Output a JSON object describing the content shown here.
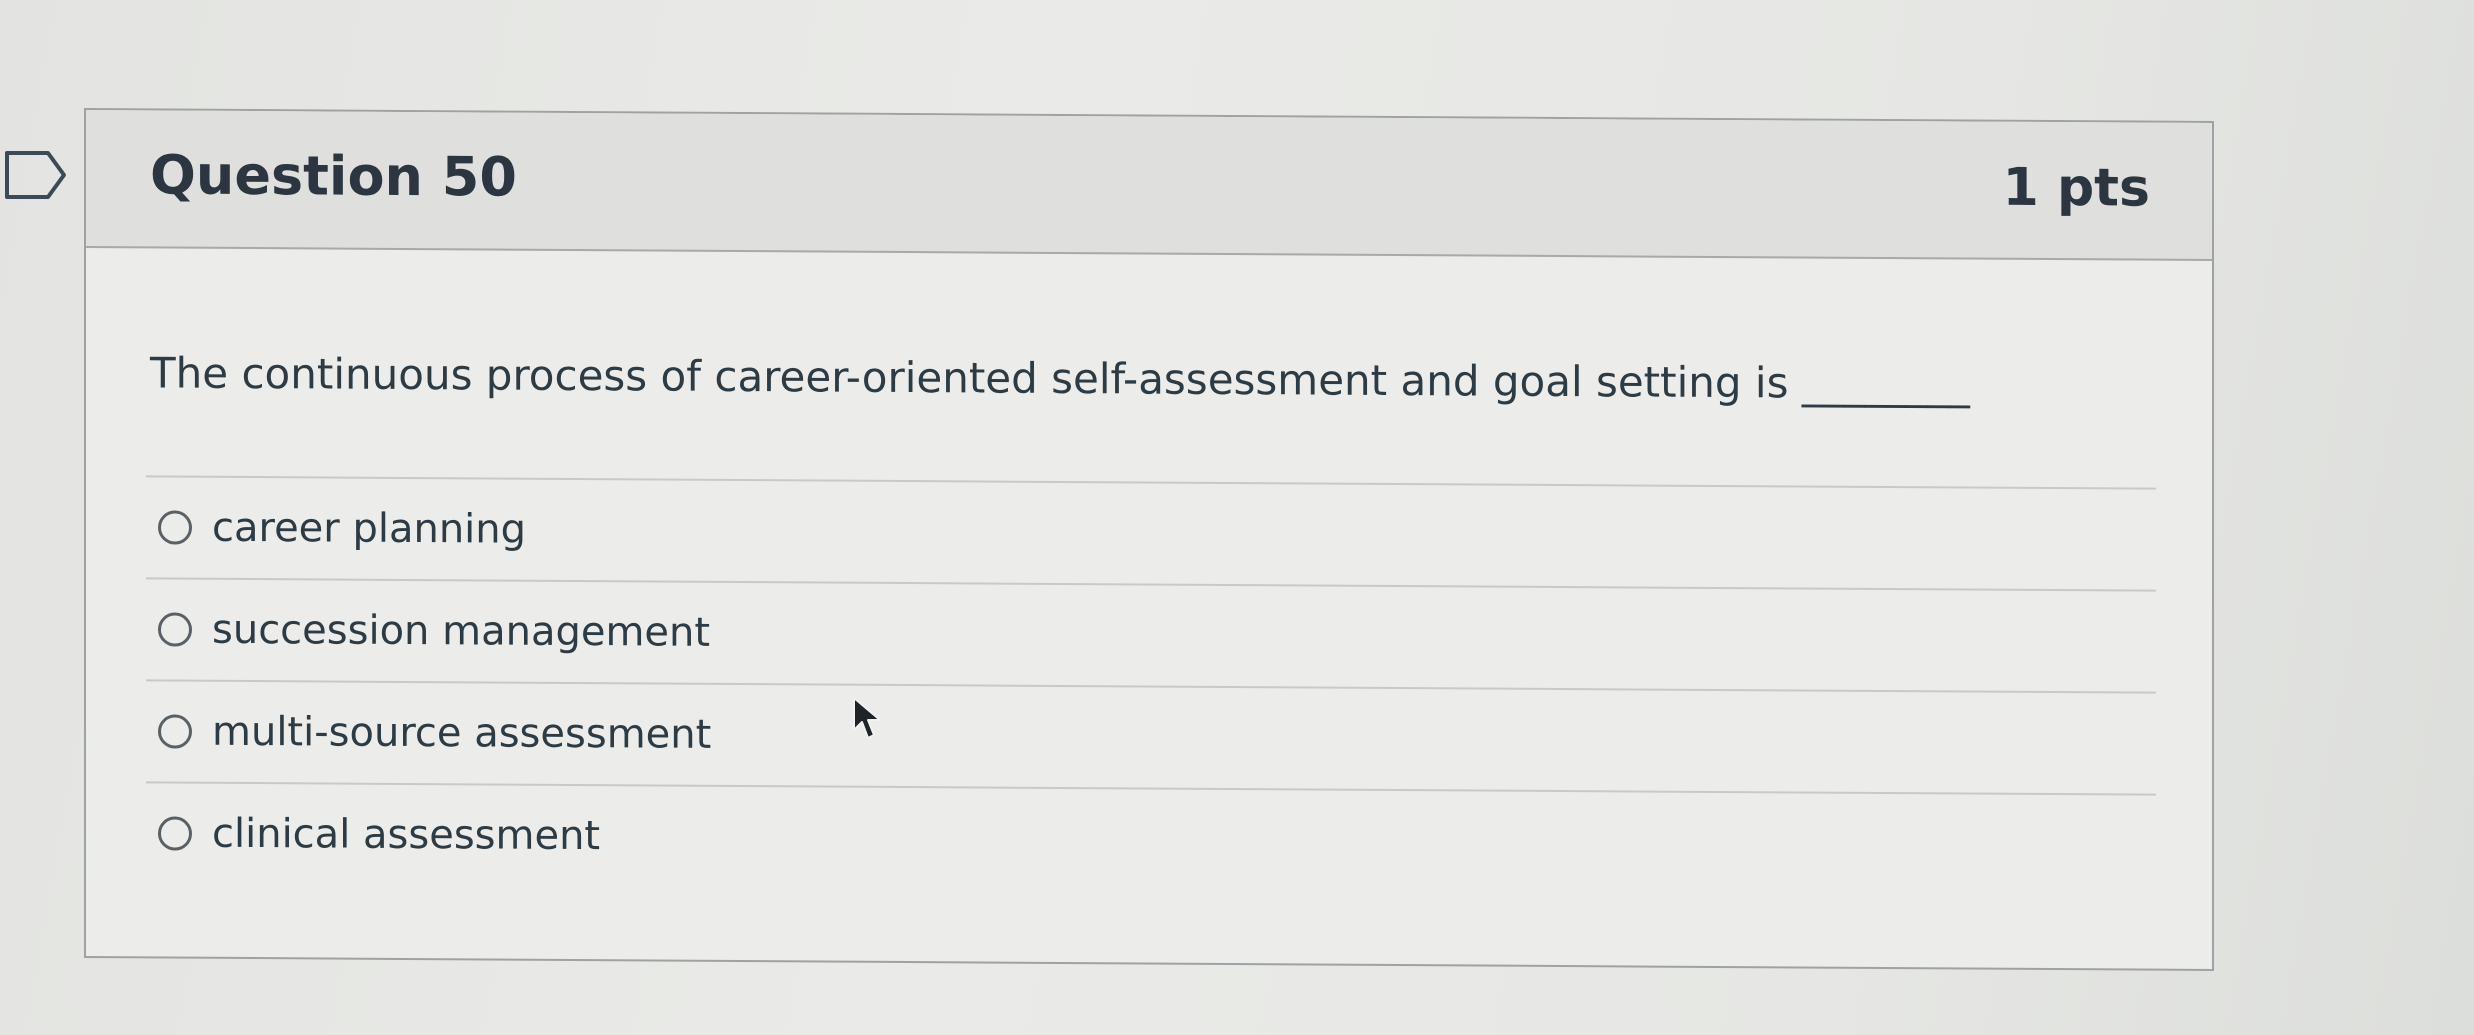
{
  "question": {
    "title": "Question 50",
    "points": "1 pts",
    "text": "The continuous process of career-oriented self-assessment and goal setting is ________",
    "answers": [
      {
        "label": "career planning",
        "selected": false
      },
      {
        "label": "succession management",
        "selected": false
      },
      {
        "label": "multi-source assessment",
        "selected": false
      },
      {
        "label": "clinical assessment",
        "selected": false
      }
    ]
  },
  "icons": {
    "flag": "flag-icon",
    "cursor": "mouse-pointer-icon"
  }
}
